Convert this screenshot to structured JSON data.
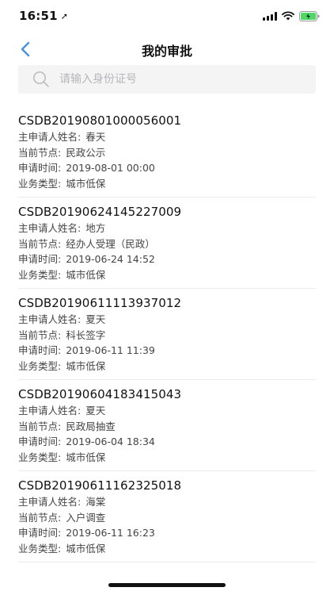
{
  "status_bar": {
    "time": "16:51"
  },
  "nav": {
    "title": "我的审批"
  },
  "search": {
    "placeholder": "请输入身份证号"
  },
  "labels": {
    "applicant": "主申请人姓名:",
    "node": "当前节点:",
    "time": "申请时间:",
    "type": "业务类型:"
  },
  "records": [
    {
      "id": "CSDB20190801000056001",
      "applicant": "春天",
      "node": "民政公示",
      "time": "2019-08-01 00:00",
      "type": "城市低保"
    },
    {
      "id": "CSDB20190624145227009",
      "applicant": "地方",
      "node": "经办人受理（民政）",
      "time": "2019-06-24 14:52",
      "type": "城市低保"
    },
    {
      "id": "CSDB20190611113937012",
      "applicant": "夏天",
      "node": "科长签字",
      "time": "2019-06-11 11:39",
      "type": "城市低保"
    },
    {
      "id": "CSDB20190604183415043",
      "applicant": "夏天",
      "node": "民政局抽查",
      "time": "2019-06-04 18:34",
      "type": "城市低保"
    },
    {
      "id": "CSDB20190611162325018",
      "applicant": "海棠",
      "node": "入户调查",
      "time": "2019-06-11 16:23",
      "type": "城市低保"
    }
  ],
  "colors": {
    "accent": "#4a90e2",
    "battery": "#4cd964"
  },
  "icons": {
    "back": "chevron-left-icon",
    "search": "search-icon"
  }
}
